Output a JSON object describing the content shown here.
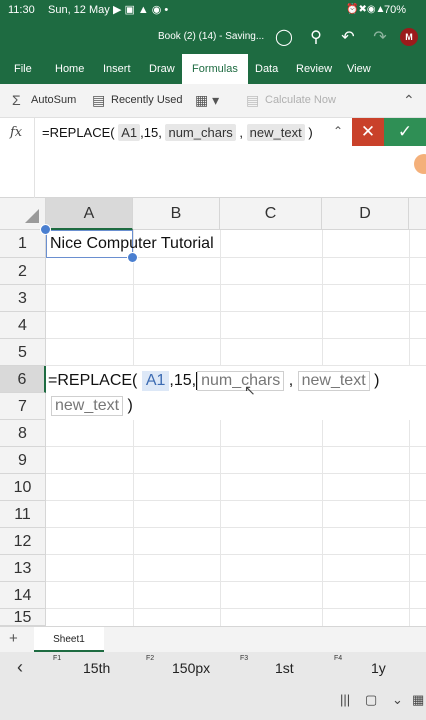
{
  "status": {
    "time": "11:30",
    "date": "Sun, 12 May",
    "battery": "70%",
    "left_icons": [
      "youtube-icon",
      "camera-icon",
      "notification-icon",
      "wifi-icon",
      "dot-icon"
    ],
    "right_icons": [
      "alarm-icon",
      "mute-icon",
      "wifi-icon",
      "signal-icon",
      "battery-icon"
    ]
  },
  "titlebar": {
    "title": "Book (2) (14) - Saving...",
    "avatar_initial": "M",
    "icons": [
      "lightbulb-icon",
      "share-icon",
      "undo-icon",
      "redo-icon"
    ]
  },
  "tabs": [
    "File",
    "Home",
    "Insert",
    "Draw",
    "Formulas",
    "Data",
    "Review",
    "View"
  ],
  "active_tab": "Formulas",
  "ribbon": {
    "autosum": "AutoSum",
    "recently_used": "Recently Used",
    "calculate_now": "Calculate Now"
  },
  "formula_bar": {
    "fx": "fx",
    "prefix": "=REPLACE(",
    "arg1": "A1",
    "arg2": ",15,",
    "arg3": "num_chars",
    "sep": ",",
    "arg4": "new_text",
    "close": ")"
  },
  "columns": [
    "A",
    "B",
    "C",
    "D"
  ],
  "rows": [
    "1",
    "2",
    "3",
    "4",
    "5",
    "6",
    "7",
    "8",
    "9",
    "10",
    "11",
    "12",
    "13",
    "14",
    "15"
  ],
  "cells": {
    "A1": "Nice Computer Tutorial"
  },
  "edit_cell": {
    "prefix": "=REPLACE(",
    "ref": "A1",
    "num": ",15,",
    "arg3": "num_chars",
    "sep": ",",
    "arg4": "new_text",
    "close": ")"
  },
  "sheet": {
    "name": "Sheet1"
  },
  "suggestions": [
    {
      "key": "F1",
      "text": "15th"
    },
    {
      "key": "F2",
      "text": "150px"
    },
    {
      "key": "F3",
      "text": "1st"
    },
    {
      "key": "F4",
      "text": "1y"
    }
  ]
}
